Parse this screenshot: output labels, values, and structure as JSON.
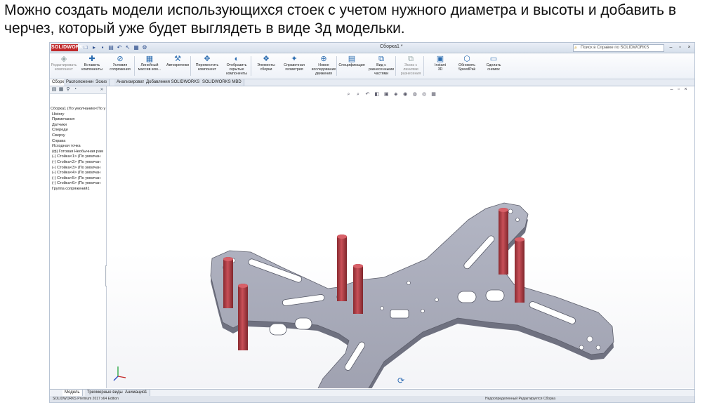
{
  "caption": "Можно создать модели использующихся стоек с учетом нужного диаметра и высоты и добавить в черчез, который уже будет выглядеть в виде 3д модельки.",
  "app": {
    "logo": "SOLIDWORKS",
    "document_title": "Сборка1 *",
    "search_placeholder": "Поиск в Справке по SOLIDWORKS",
    "quick_access": [
      "□",
      "▸",
      "▪",
      "▤",
      "↶",
      "↖",
      "▦",
      "⚙"
    ]
  },
  "command_manager": [
    {
      "label": "Редактировать\nкомпонент",
      "icon": "edit-component-icon",
      "glyph": "◈",
      "dim": true
    },
    {
      "label": "Вставить\nкомпоненты",
      "icon": "insert-components-icon",
      "glyph": "✚"
    },
    {
      "label": "Условия\nсопряжения",
      "icon": "mate-icon",
      "glyph": "⊘"
    },
    {
      "label": "Линейный\nмассив ком...",
      "icon": "linear-pattern-icon",
      "glyph": "▦"
    },
    {
      "label": "Автокрепежи",
      "icon": "smart-fasteners-icon",
      "glyph": "⚒"
    },
    {
      "label": "Переместить\nкомпонент",
      "icon": "move-component-icon",
      "glyph": "✥"
    },
    {
      "label": "Отобразить\nскрытые\nкомпоненты",
      "icon": "show-hidden-icon",
      "glyph": "◐"
    },
    {
      "label": "Элементы\nсборки",
      "icon": "assembly-features-icon",
      "glyph": "❖"
    },
    {
      "label": "Справочная\nгеометрия",
      "icon": "reference-geometry-icon",
      "glyph": "✦"
    },
    {
      "label": "Новое\nисследование\nдвижения",
      "icon": "motion-study-icon",
      "glyph": "⊕"
    },
    {
      "label": "Спецификация",
      "icon": "bom-icon",
      "glyph": "▤"
    },
    {
      "label": "Вид с\nразнесенными\nчастями",
      "icon": "exploded-view-icon",
      "glyph": "⧉"
    },
    {
      "label": "Эскиз с\nлиниями\nразнесения",
      "icon": "explode-line-sketch-icon",
      "glyph": "⧉",
      "dim": true
    },
    {
      "label": "Instant\n3D",
      "icon": "instant3d-icon",
      "glyph": "▣"
    },
    {
      "label": "Обновить\nSpeedPak",
      "icon": "speedpak-icon",
      "glyph": "⬡"
    },
    {
      "label": "Сделать\nснимок",
      "icon": "snapshot-icon",
      "glyph": "▭"
    }
  ],
  "tabs": [
    "Сборка",
    "Расположение",
    "Эскиз",
    "Анализировать",
    "Добавления SOLIDWORKS",
    "SOLIDWORKS MBD"
  ],
  "tree": {
    "items": [
      "Сборка1 (По умолчанию<По у",
      "History",
      "Примечания",
      "Датчики",
      "Спереди",
      "Сверху",
      "Справа",
      "Исходная точка",
      "(ф) Готовая Необычная рам",
      "(-) Стойка<1> (По умолчан",
      "(-) Стойка<2> (По умолчан",
      "(-) Стойка<3> (По умолчан",
      "(-) Стойка<4> (По умолчан",
      "(-) Стойка<5> (По умолчан",
      "(-) Стойка<6> (По умолчан",
      "Группа сопряжений1"
    ]
  },
  "bottom_tabs": [
    "Модель",
    "Трехмерные виды",
    "Анимация1"
  ],
  "status_left": "SOLIDWORKS Premium 2017 x64 Edition",
  "status_right": "Недоопределенный   Редактируется Сборка",
  "colors": {
    "plate": "#a7aab8",
    "plate_edge": "#7a7c8a",
    "standoff": "#b9444a",
    "accent": "#c0282a"
  }
}
